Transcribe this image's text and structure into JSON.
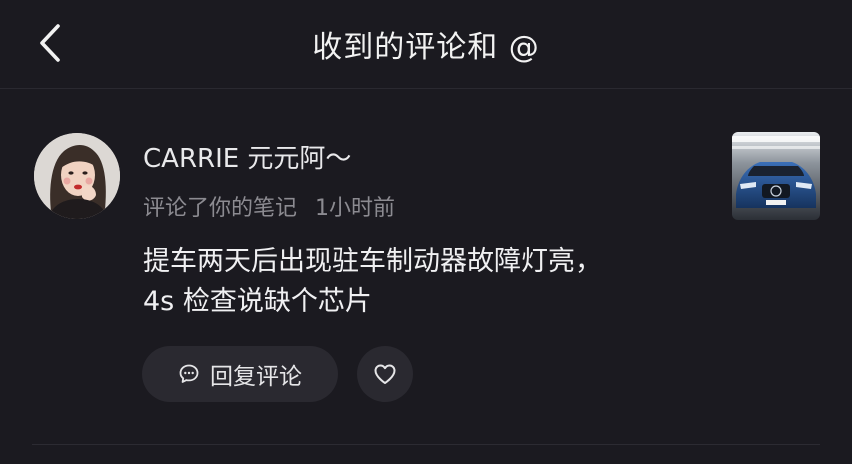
{
  "header": {
    "title": "收到的评论和 @",
    "back_icon": "chevron-left-icon"
  },
  "comment": {
    "user_name": "CARRIE 元元阿～",
    "action": "评论了你的笔记",
    "time": "1小时前",
    "text_line1": "提车两天后出现驻车制动器故障灯亮，",
    "text_line2": "4s 检查说缺个芯片",
    "reply_label": "回复评论",
    "reply_icon": "comment-bubble-icon",
    "like_icon": "heart-outline-icon"
  },
  "colors": {
    "background": "#1b1a20",
    "button_bg": "#2a2930",
    "secondary_text": "#8c8b91"
  }
}
